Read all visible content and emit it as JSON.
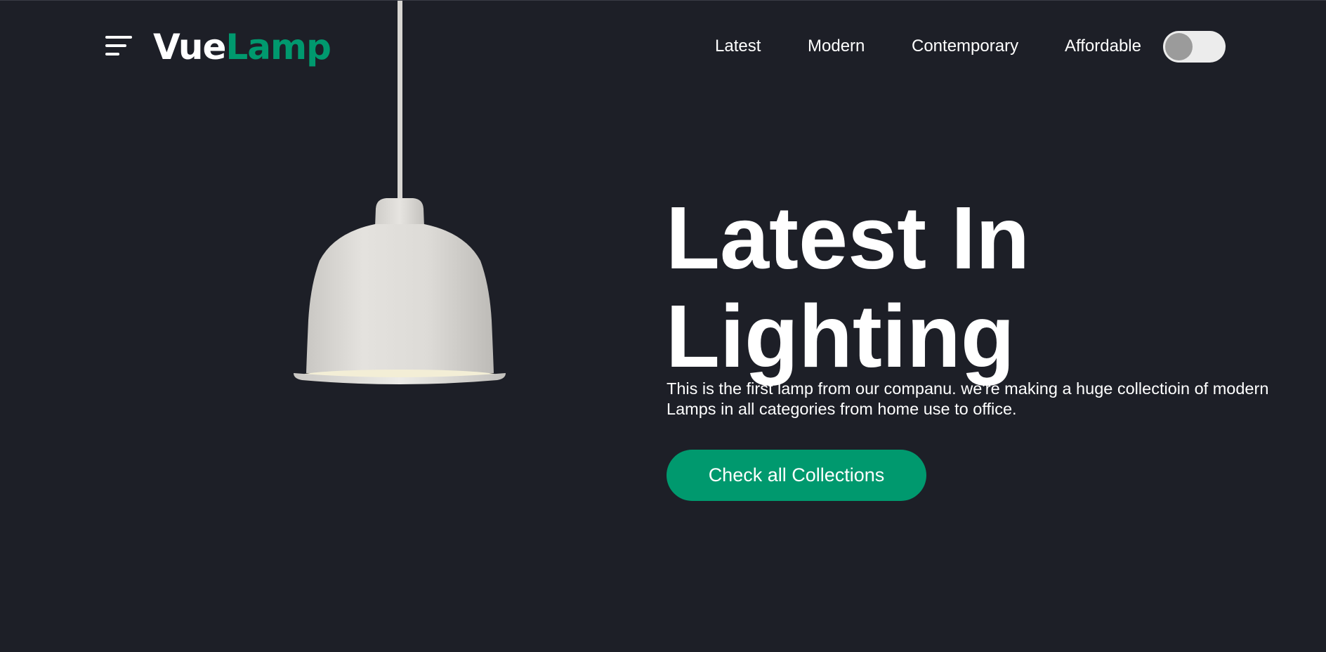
{
  "brand": {
    "name_part1": "Vue",
    "name_part2": "Lamp",
    "accent_color": "#00996e",
    "background_color": "#1d1f27"
  },
  "header": {
    "menu_icon": "hamburger-menu-icon",
    "nav": [
      {
        "label": "Latest"
      },
      {
        "label": "Modern"
      },
      {
        "label": "Contemporary"
      },
      {
        "label": "Affordable"
      }
    ],
    "theme_toggle": {
      "state": "off"
    }
  },
  "hero": {
    "title_line1": "Latest In",
    "title_line2": "Lighting",
    "description": "This is the first lamp from our companu. we're making a huge collectioin of modern Lamps in all categories from home use to office.",
    "cta_label": "Check all Collections"
  }
}
